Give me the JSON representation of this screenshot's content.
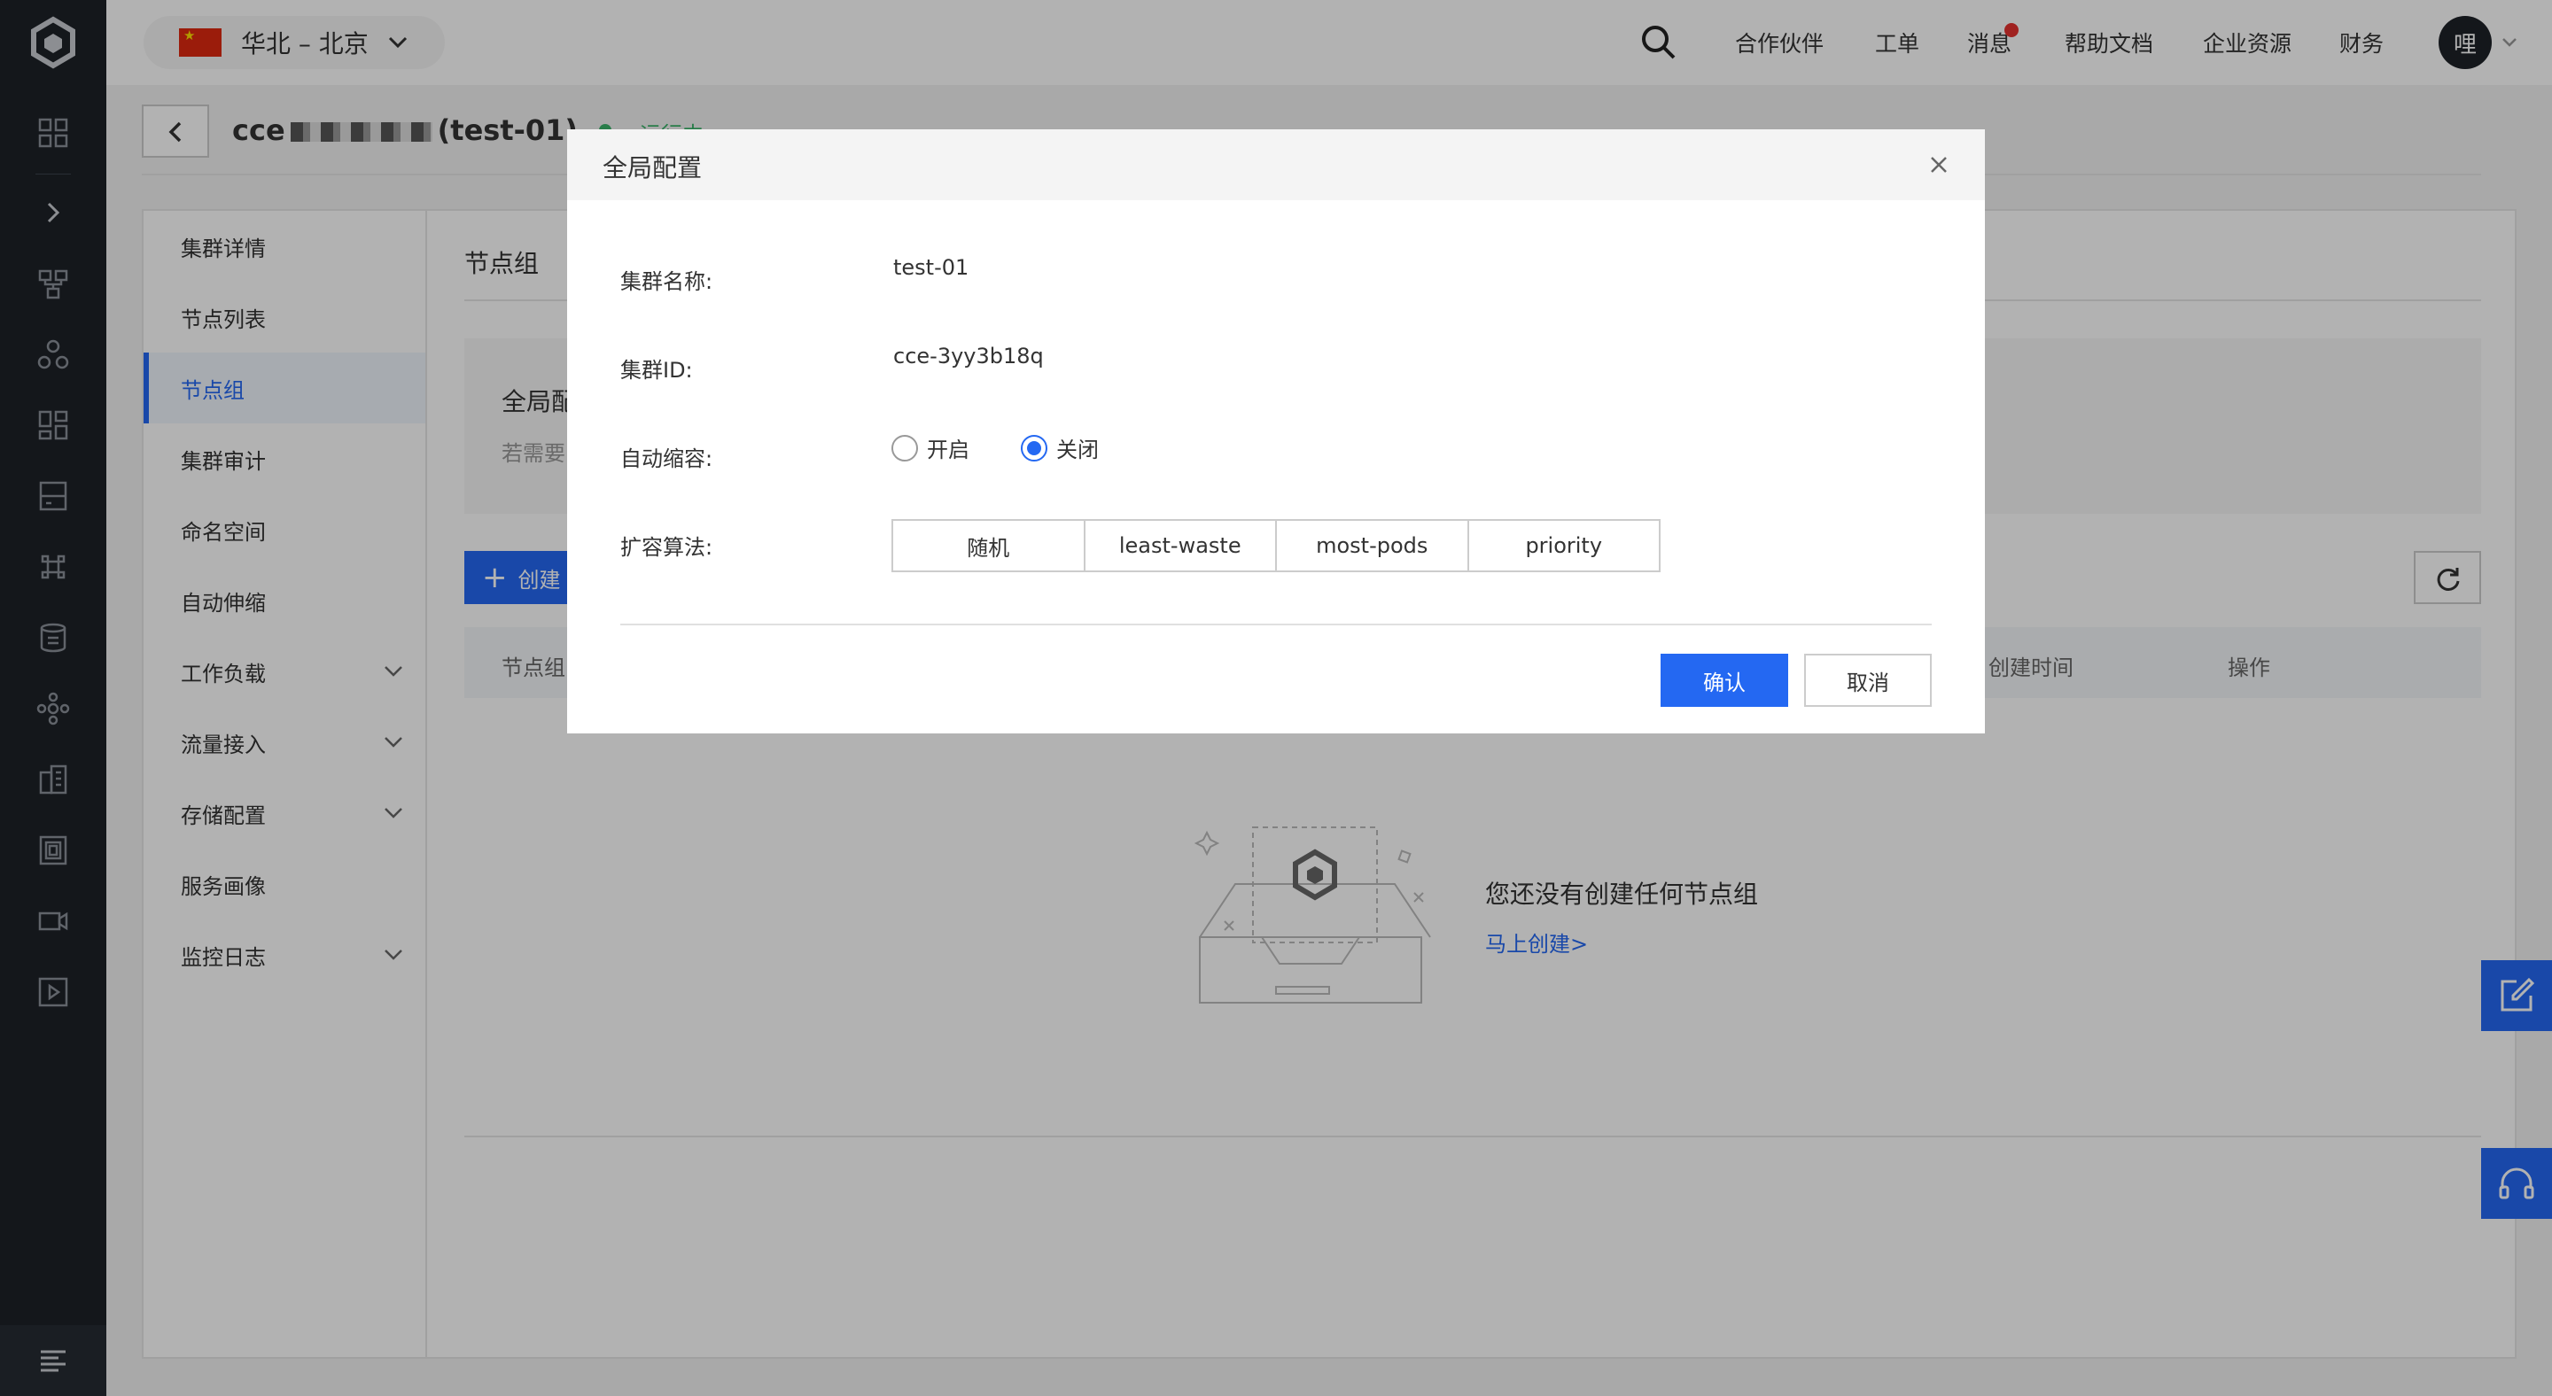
{
  "topbar": {
    "region": "华北 – 北京",
    "nav": [
      "合作伙伴",
      "工单",
      "消息",
      "帮助文档",
      "企业资源",
      "财务"
    ],
    "avatar_text": "哩"
  },
  "page": {
    "cluster_title_prefix": "cce",
    "cluster_title_suffix": "(test-01)",
    "status": "运行中"
  },
  "sidenav": {
    "items": [
      {
        "label": "集群详情"
      },
      {
        "label": "节点列表"
      },
      {
        "label": "节点组"
      },
      {
        "label": "集群审计"
      },
      {
        "label": "命名空间"
      },
      {
        "label": "自动伸缩"
      },
      {
        "label": "工作负载"
      },
      {
        "label": "流量接入"
      },
      {
        "label": "存储配置"
      },
      {
        "label": "服务画像"
      },
      {
        "label": "监控日志"
      }
    ]
  },
  "content": {
    "tab_title": "节点组",
    "global_card_title": "全局配",
    "global_card_hint": "若需要",
    "create_button": "创建",
    "table_columns": [
      "节点组",
      "创建时间",
      "操作"
    ],
    "empty_title": "您还没有创建任何节点组",
    "empty_link": "马上创建>"
  },
  "dialog": {
    "title": "全局配置",
    "fields": {
      "cluster_name_label": "集群名称:",
      "cluster_name_value": "test-01",
      "cluster_id_label": "集群ID:",
      "cluster_id_value": "cce-3yy3b18q",
      "autoscale_label": "自动缩容:",
      "autoscale_options": [
        "开启",
        "关闭"
      ],
      "autoscale_selected": "关闭",
      "expander_label": "扩容算法:",
      "expander_options": [
        "随机",
        "least-waste",
        "most-pods",
        "priority"
      ]
    },
    "confirm": "确认",
    "cancel": "取消"
  },
  "colors": {
    "accent": "#2468f2",
    "rail": "#1d2128",
    "status": "#3bb36b"
  }
}
